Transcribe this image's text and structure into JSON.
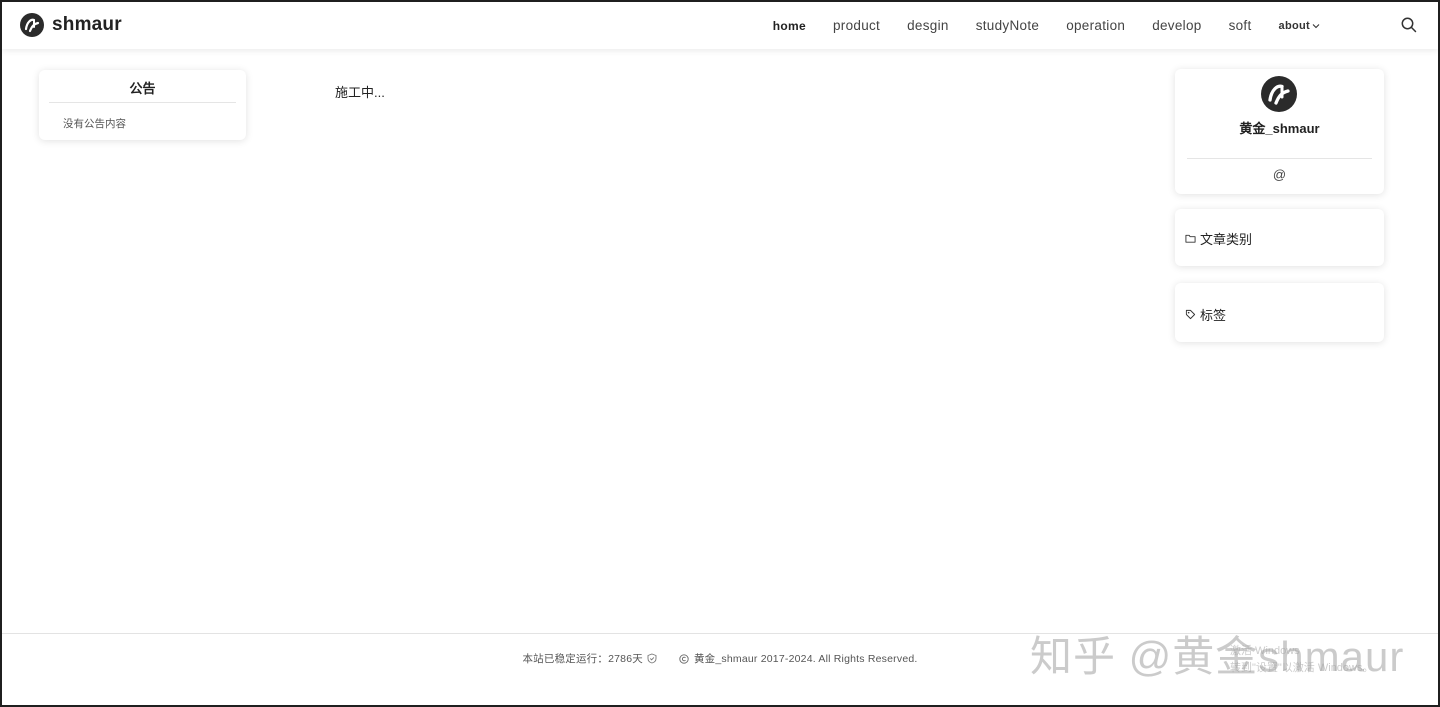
{
  "header": {
    "brand_name": "shmaur",
    "nav": {
      "home": "home",
      "product": "product",
      "desgin": "desgin",
      "studyNote": "studyNote",
      "operation": "operation",
      "develop": "develop",
      "soft": "soft",
      "about": "about"
    },
    "icons": {
      "logo": "logo-icon",
      "about_dropdown": "chevron-down-icon",
      "search": "search-icon"
    }
  },
  "notice": {
    "title": "公告",
    "text": "没有公告内容"
  },
  "main": {
    "text": "施工中..."
  },
  "profile": {
    "name": "黄金_shmaur",
    "contact": "@",
    "avatar_icon": "avatar-icon"
  },
  "categories": {
    "label": "文章类别",
    "icon": "folder-icon"
  },
  "tags": {
    "label": "标签",
    "icon": "tag-icon"
  },
  "footer": {
    "uptime": "本站已稳定运行：2786天",
    "uptime_icon": "shield-icon",
    "copyright_icon": "copyright-icon",
    "copyright": "黄金_shmaur 2017-2024. All Rights Reserved."
  },
  "overlay": {
    "watermark": "知乎 @黄金shmaur",
    "activate_line1": "激活 Windows",
    "activate_line2": "转到\"设置\"以激活 Windows。"
  },
  "colors": {
    "text": "#222222",
    "muted": "#555555",
    "logo_bg": "#2b2b2b",
    "card_bg": "#ffffff"
  }
}
